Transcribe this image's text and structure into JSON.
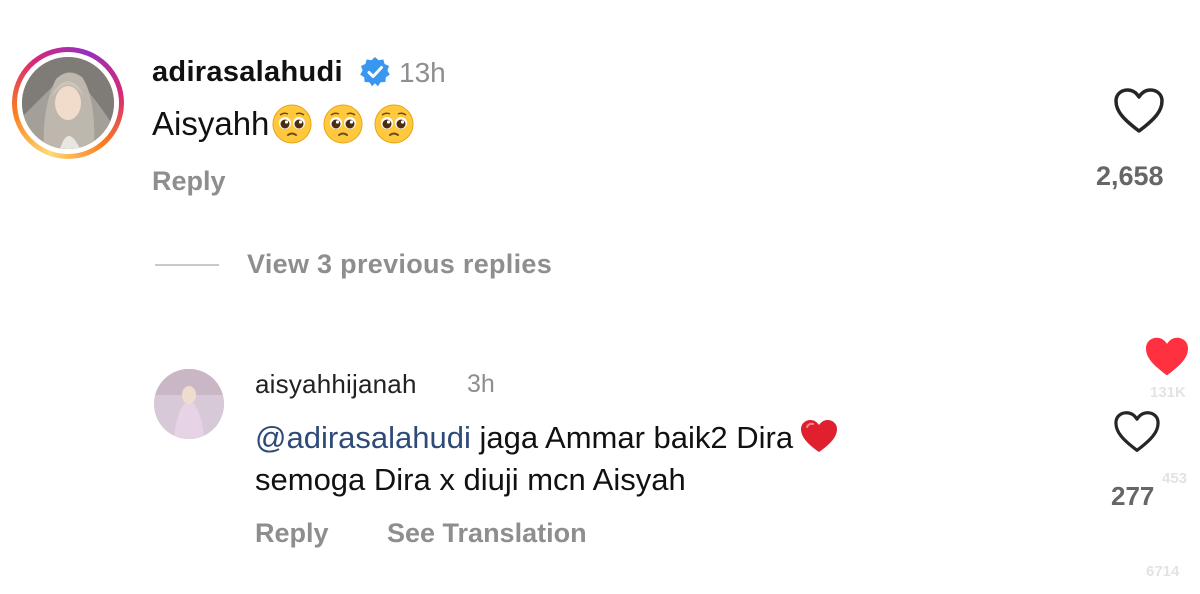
{
  "comment": {
    "username": "adirasalahudi",
    "time": "13h",
    "text": "Aisyahh",
    "emojis": [
      "pleading-face",
      "pleading-face",
      "pleading-face"
    ],
    "reply_label": "Reply",
    "like_count": "2,658",
    "verified": true
  },
  "replies_toggle": {
    "label": "View 3 previous replies"
  },
  "reply": {
    "username": "aisyahhijanah",
    "time": "3h",
    "mention": "@adirasalahudi",
    "text_line1": " jaga Ammar baik2 Dira",
    "text_line2": "semoga Dira x diuji mcn Aisyah",
    "emoji": "red-heart",
    "reply_label": "Reply",
    "translate_label": "See Translation",
    "like_count": "277"
  },
  "overlay": {
    "liked_count": "131K",
    "count_b": "453",
    "count_c": "6714"
  },
  "colors": {
    "muted": "#8e8e8e",
    "mention": "#2e4b78",
    "like_red": "#ff3040",
    "verified_blue": "#3897f0"
  }
}
